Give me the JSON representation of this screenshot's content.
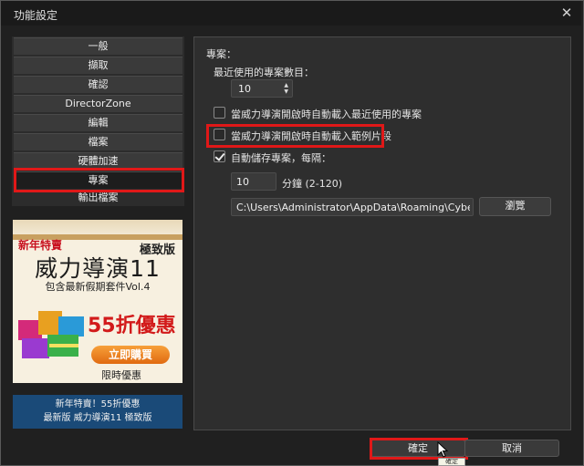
{
  "window": {
    "title": "功能設定",
    "close_glyph": "✕"
  },
  "nav": {
    "items": [
      {
        "label": "一般"
      },
      {
        "label": "擷取"
      },
      {
        "label": "確認"
      },
      {
        "label": "DirectorZone"
      },
      {
        "label": "編輯"
      },
      {
        "label": "檔案"
      },
      {
        "label": "硬體加速"
      },
      {
        "label": "專案"
      },
      {
        "label": "輸出檔案"
      }
    ],
    "selected_index": 7
  },
  "promo": {
    "tag": "新年特賣",
    "edition": "極致版",
    "product": "威力導演11",
    "includes": "包含最新假期套件Vol.4",
    "discount": "55折優惠",
    "buy_button": "立即購買",
    "limited": "限時優惠"
  },
  "banner": {
    "line1": "新年特賣！55折優惠",
    "line2": "最新版 威力導演11 極致版"
  },
  "project": {
    "section_title": "專案：",
    "recent_label": "最近使用的專案數目：",
    "recent_count": "10",
    "auto_load_recent": {
      "label": "當威力導演開啟時自動載入最近使用的專案",
      "checked": false
    },
    "auto_load_sample": {
      "label": "當威力導演開啟時自動載入範例片段",
      "checked": false
    },
    "autosave": {
      "label": "自動儲存專案，每隔：",
      "checked": true
    },
    "autosave_interval": "10",
    "autosave_unit": "分鐘 (2-120)",
    "autosave_path": "C:\\Users\\Administrator\\AppData\\Roaming\\CyberLink\\I",
    "browse_button": "瀏覽"
  },
  "footer": {
    "ok_button": "確定",
    "cancel_button": "取消",
    "tooltip": "確定"
  },
  "colors": {
    "highlight": "#e01818",
    "background": "#202020",
    "panel": "#2e2e2e"
  }
}
